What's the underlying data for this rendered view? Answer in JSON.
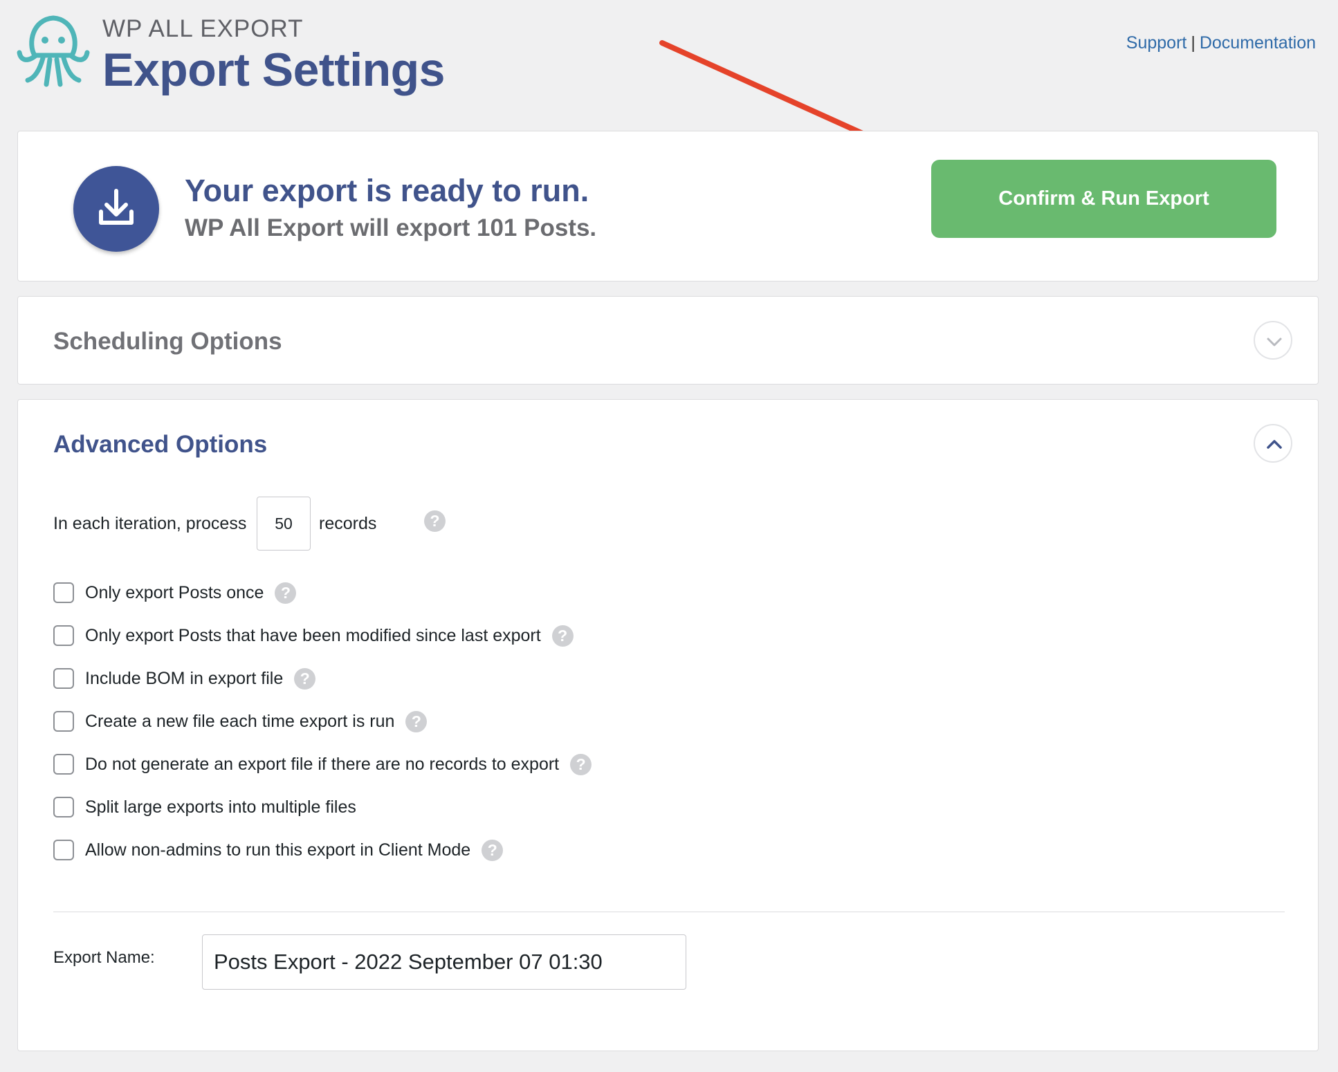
{
  "header": {
    "brand": "WP ALL EXPORT",
    "title": "Export Settings",
    "links": {
      "support": "Support",
      "separator": "|",
      "documentation": "Documentation"
    }
  },
  "ready": {
    "title": "Your export is ready to run.",
    "subtitle": "WP All Export will export 101 Posts.",
    "run_button": "Confirm & Run Export"
  },
  "scheduling": {
    "title": "Scheduling Options",
    "toggle_icon": "chevron-down-icon"
  },
  "advanced": {
    "title": "Advanced Options",
    "toggle_icon": "chevron-up-icon",
    "iteration": {
      "prefix": "In each iteration, process",
      "value": "50",
      "suffix": "records"
    },
    "options": [
      {
        "label": "Only export Posts once",
        "checked": false,
        "help": true
      },
      {
        "label": "Only export Posts that have been modified since last export",
        "checked": false,
        "help": true
      },
      {
        "label": "Include BOM in export file",
        "checked": false,
        "help": true
      },
      {
        "label": "Create a new file each time export is run",
        "checked": false,
        "help": true
      },
      {
        "label": "Do not generate an export file if there are no records to export",
        "checked": false,
        "help": true
      },
      {
        "label": "Split large exports into multiple files",
        "checked": false,
        "help": false
      },
      {
        "label": "Allow non-admins to run this export in Client Mode",
        "checked": false,
        "help": true
      }
    ],
    "export_name": {
      "label": "Export Name:",
      "value": "Posts Export - 2022 September 07 01:30"
    }
  },
  "colors": {
    "brand": "#40538b",
    "run_button": "#69ba6f",
    "arrow": "#e5432a",
    "logo": "#4fb5b8"
  }
}
